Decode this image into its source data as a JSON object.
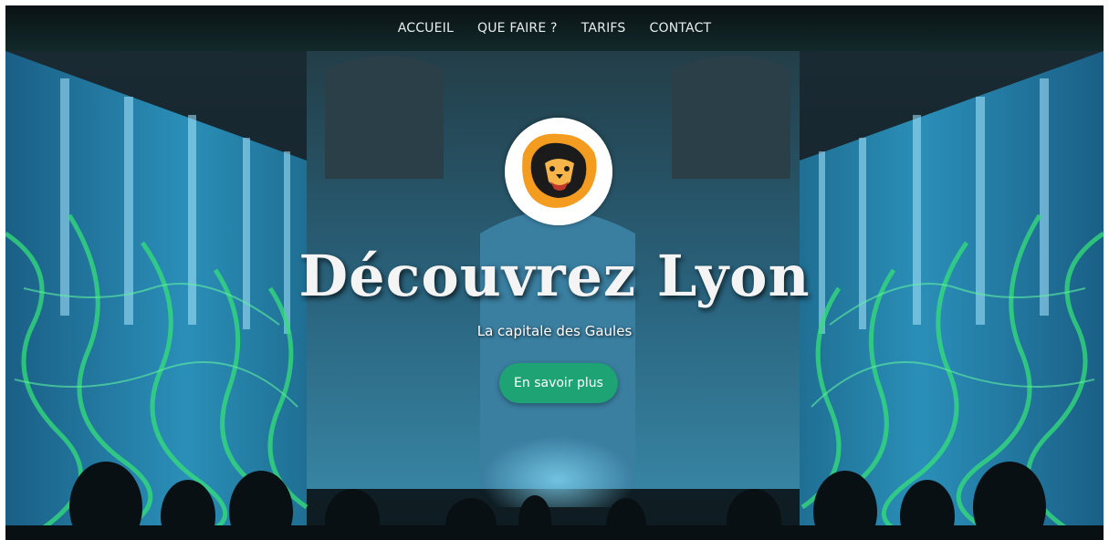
{
  "nav": {
    "items": [
      {
        "label": "ACCUEIL"
      },
      {
        "label": "QUE FAIRE ?"
      },
      {
        "label": "TARIFS"
      },
      {
        "label": "CONTACT"
      }
    ]
  },
  "hero": {
    "title": "Découvrez Lyon",
    "subtitle": "La capitale des Gaules",
    "cta_label": "En savoir plus"
  },
  "colors": {
    "nav_bg": "#12292a",
    "cta_bg": "#1ea374",
    "logo_orange": "#f39c1f",
    "facade_blue": "#2a8fb8",
    "laser_green": "#35e07a"
  },
  "icons": {
    "logo": "lion-head-icon"
  }
}
